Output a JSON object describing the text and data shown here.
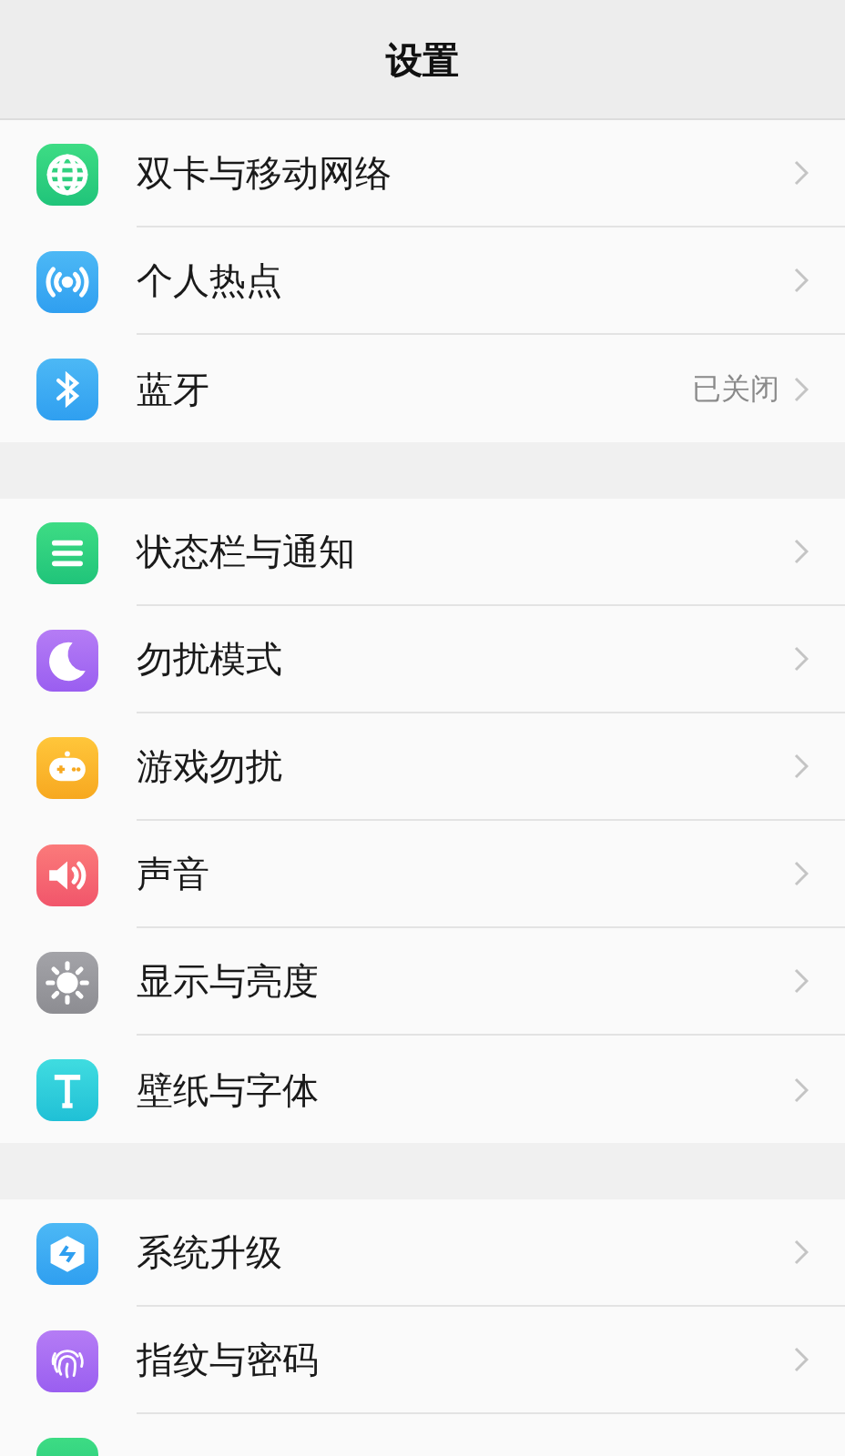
{
  "header": {
    "title": "设置"
  },
  "groups": [
    {
      "items": [
        {
          "kind": "globe",
          "label": "双卡与移动网络"
        },
        {
          "kind": "hotspot",
          "label": "个人热点"
        },
        {
          "kind": "bluetooth",
          "label": "蓝牙",
          "value": "已关闭"
        }
      ]
    },
    {
      "items": [
        {
          "kind": "statusbar",
          "label": "状态栏与通知"
        },
        {
          "kind": "moon",
          "label": "勿扰模式"
        },
        {
          "kind": "game",
          "label": "游戏勿扰"
        },
        {
          "kind": "sound",
          "label": "声音"
        },
        {
          "kind": "sun",
          "label": "显示与亮度"
        },
        {
          "kind": "font",
          "label": "壁纸与字体"
        }
      ]
    },
    {
      "items": [
        {
          "kind": "update",
          "label": "系统升级"
        },
        {
          "kind": "fingerprint",
          "label": "指纹与密码"
        },
        {
          "kind": "blank"
        }
      ]
    }
  ]
}
